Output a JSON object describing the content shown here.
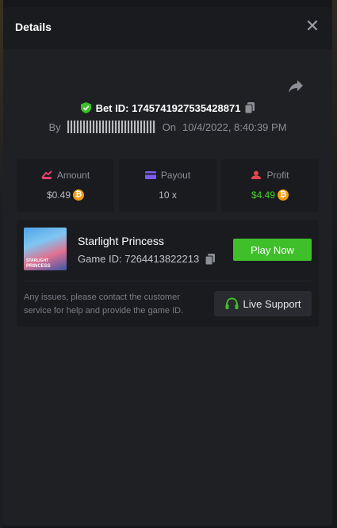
{
  "modal": {
    "title": "Details"
  },
  "bet": {
    "id_label": "Bet ID: 1745741927535428871",
    "by_label": "By",
    "on_label": "On",
    "datetime": "10/4/2022, 8:40:39 PM"
  },
  "stats": [
    {
      "label": "Amount",
      "value": "$0.49",
      "has_coin": true,
      "value_color": "#b8bac0",
      "icon": "amount-icon"
    },
    {
      "label": "Payout",
      "value": "10 x",
      "has_coin": false,
      "value_color": "#b8bac0",
      "icon": "payout-icon"
    },
    {
      "label": "Profit",
      "value": "$4.49",
      "has_coin": true,
      "value_color": "#46d12d",
      "icon": "profit-icon"
    }
  ],
  "game": {
    "name": "Starlight Princess",
    "game_id_label": "Game ID: 7264413822213",
    "thumb_line1": "STARLIGHT",
    "thumb_line2": "PRINCESS",
    "play_label": "Play Now",
    "notice": "Any issues, please contact the customer service for help and provide the game ID.",
    "support_label": "Live Support"
  },
  "coin_symbol": "₿",
  "colors": {
    "accent_green": "#3fbf2a",
    "profit_green": "#46d12d",
    "coin_orange": "#f39c12",
    "amount_pink": "#e5416b",
    "payout_purple": "#7b5cf0",
    "profit_red": "#e0474c"
  }
}
